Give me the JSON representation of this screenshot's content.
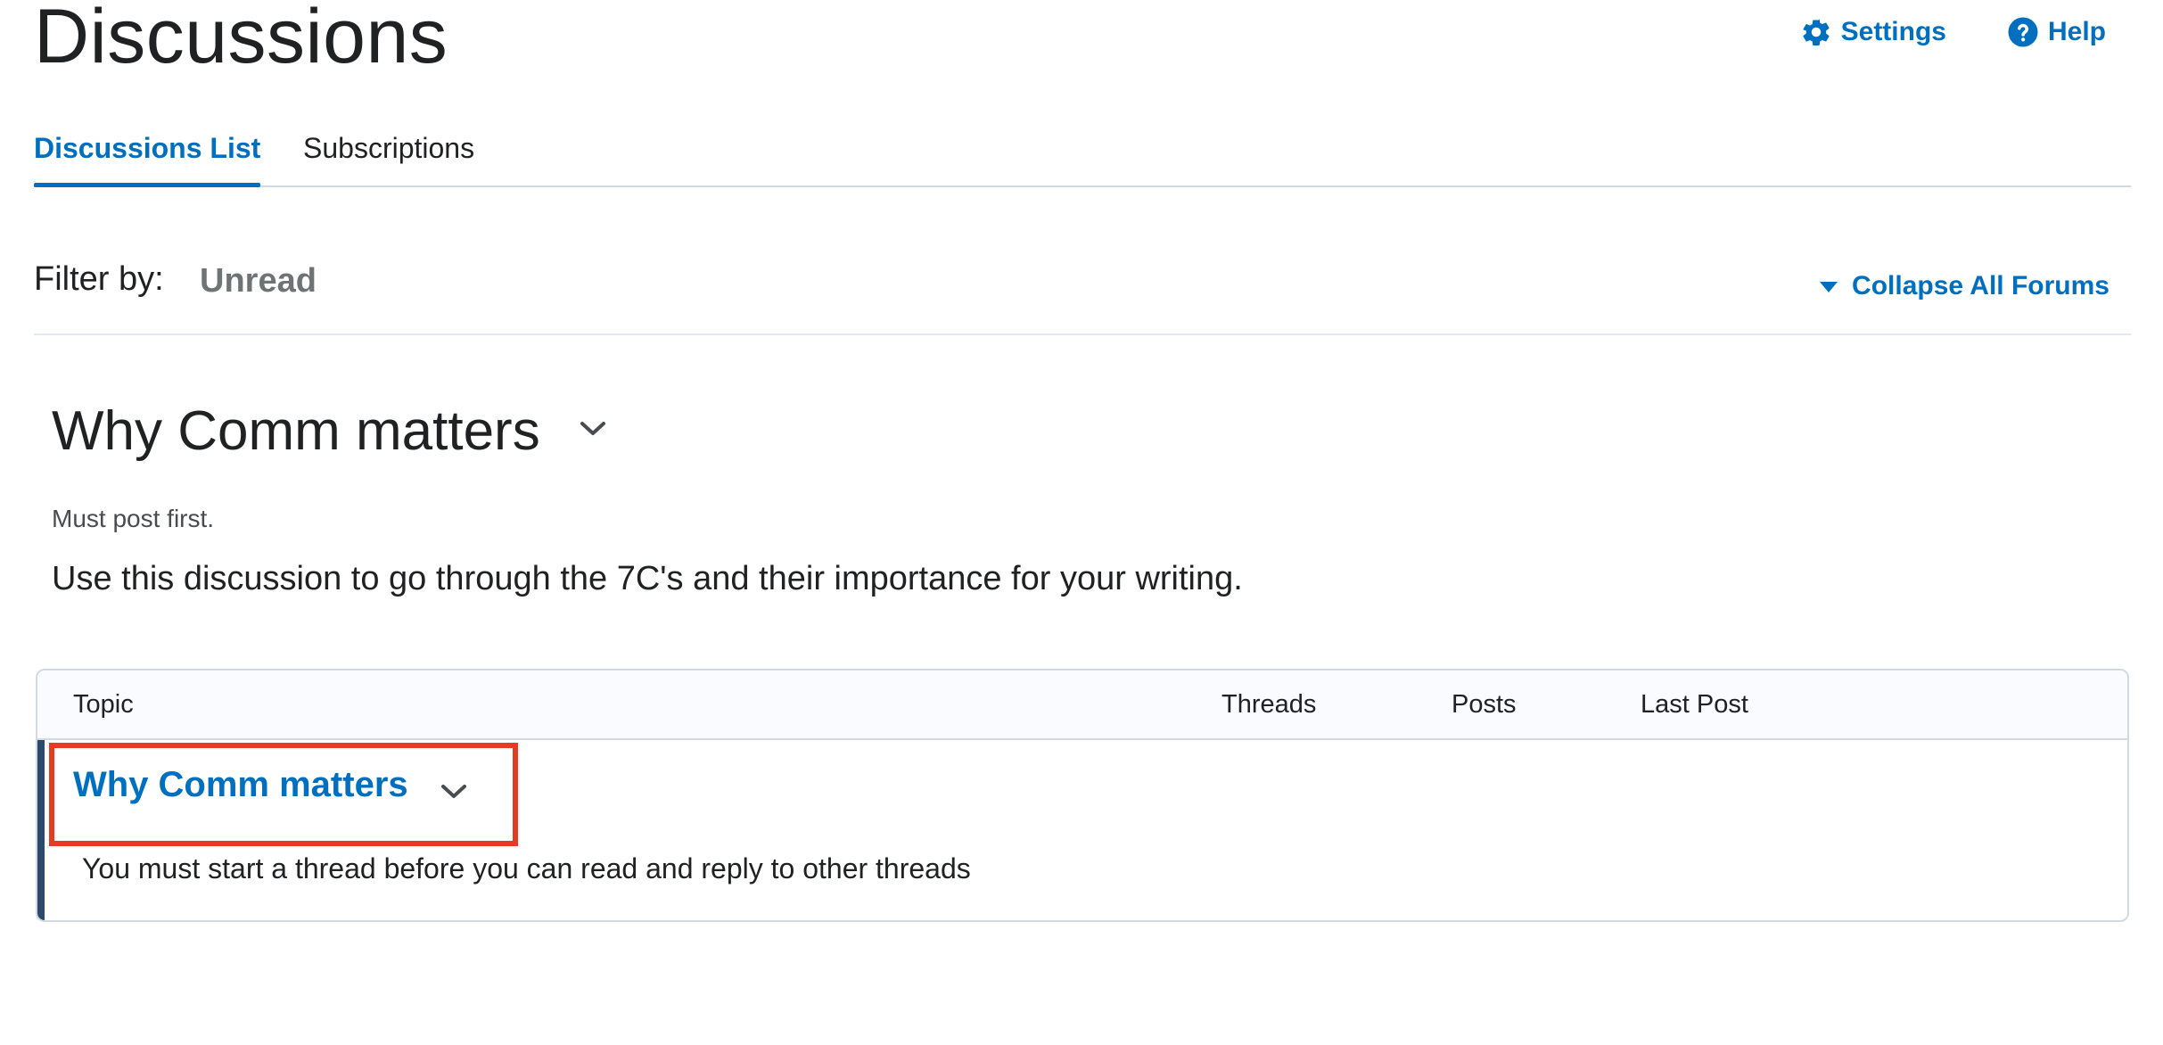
{
  "header": {
    "title": "Discussions",
    "settings_label": "Settings",
    "help_label": "Help",
    "icons": {
      "settings": "gear-icon",
      "help": "question-circle-icon"
    }
  },
  "tabs": [
    {
      "label": "Discussions List",
      "active": true
    },
    {
      "label": "Subscriptions",
      "active": false
    }
  ],
  "filter": {
    "label": "Filter by:",
    "value": "Unread",
    "collapse_all_label": "Collapse All Forums"
  },
  "forum": {
    "title": "Why Comm matters",
    "restriction": "Must post first.",
    "description": "Use this discussion to go through the 7C's and their importance for your writing."
  },
  "table": {
    "columns": [
      "Topic",
      "Threads",
      "Posts",
      "Last Post"
    ],
    "rows": [
      {
        "topic": "Why Comm matters",
        "note": "You must start a thread before you can read and reply to other threads"
      }
    ]
  },
  "colors": {
    "link_blue": "#006fbf",
    "highlight_red": "#e63a24",
    "row_accent": "#2e4a6b"
  }
}
